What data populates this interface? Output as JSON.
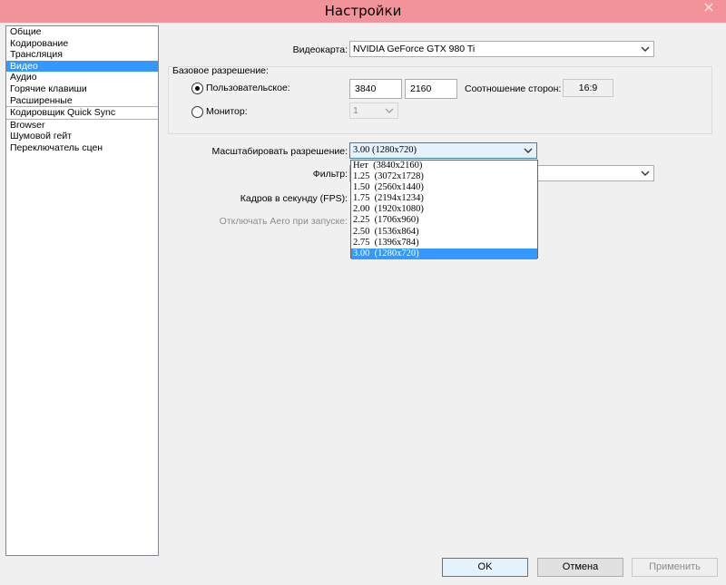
{
  "window": {
    "title": "Настройки"
  },
  "sidebar": {
    "items": [
      {
        "label": "Общие"
      },
      {
        "label": "Кодирование"
      },
      {
        "label": "Трансляция"
      },
      {
        "label": "Видео"
      },
      {
        "label": "Аудио"
      },
      {
        "label": "Горячие клавиши"
      },
      {
        "label": "Расширенные"
      },
      {
        "label": "Кодировщик Quick Sync"
      },
      {
        "label": "Browser"
      },
      {
        "label": "Шумовой гейт"
      },
      {
        "label": "Переключатель сцен"
      }
    ],
    "selected": "Видео"
  },
  "video": {
    "adapter_label": "Видеокарта:",
    "adapter_value": "NVIDIA GeForce GTX 980 Ti",
    "base_res_group": "Базовое разрешение:",
    "custom_label": "Пользовательское:",
    "width": "3840",
    "height": "2160",
    "aspect_label": "Соотношение сторон:",
    "aspect_value": "16:9",
    "monitor_label": "Монитор:",
    "monitor_value": "1",
    "downscale_label": "Масштабировать разрешение:",
    "downscale_value": "3.00  (1280x720)",
    "filter_label": "Фильтр:",
    "fps_label": "Кадров в секунду (FPS):",
    "aero_label": "Отключать Aero при запуске:",
    "downscale_options": [
      "Нет  (3840x2160)",
      "1.25  (3072x1728)",
      "1.50  (2560x1440)",
      "1.75  (2194x1234)",
      "2.00  (1920x1080)",
      "2.25  (1706x960)",
      "2.50  (1536x864)",
      "2.75  (1396x784)",
      "3.00  (1280x720)"
    ],
    "downscale_selected": "3.00  (1280x720)"
  },
  "buttons": {
    "ok": "OK",
    "cancel": "Отмена",
    "apply": "Применить"
  },
  "icons": {
    "close": "close-icon",
    "combo_arrow": "chevron-down-icon"
  },
  "colors": {
    "titlebar": "#f2939b",
    "selection": "#3399ff"
  }
}
